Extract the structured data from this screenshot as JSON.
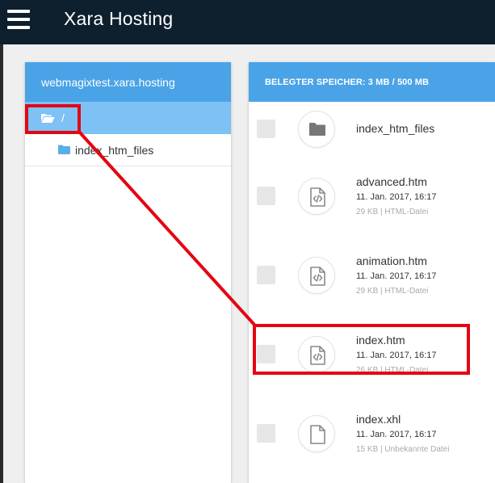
{
  "app": {
    "title": "Xara Hosting"
  },
  "left_panel": {
    "header": "webmagixtest.xara.hosting",
    "root_label": "/",
    "child_folder": "index_htm_files"
  },
  "right_panel": {
    "header": "BELEGTER SPEICHER: 3 MB / 500 MB",
    "files": [
      {
        "name": "index_htm_files",
        "date": "",
        "meta": "",
        "icon": "folder-icon"
      },
      {
        "name": "advanced.htm",
        "date": "11. Jan. 2017, 16:17",
        "meta": "29 KB | HTML-Datei",
        "icon": "html-file-icon"
      },
      {
        "name": "animation.htm",
        "date": "11. Jan. 2017, 16:17",
        "meta": "29 KB | HTML-Datei",
        "icon": "html-file-icon"
      },
      {
        "name": "index.htm",
        "date": "11. Jan. 2017, 16:17",
        "meta": "26 KB | HTML-Datei",
        "icon": "html-file-icon"
      },
      {
        "name": "index.xhl",
        "date": "11. Jan. 2017, 16:17",
        "meta": "15 KB | Unbekannte Datei",
        "icon": "generic-file-icon"
      }
    ]
  },
  "colors": {
    "topbar": "#0e1f2e",
    "panel_header": "#4aa3e6",
    "selected_row": "#7dc1f5",
    "annotation": "#e30613"
  }
}
